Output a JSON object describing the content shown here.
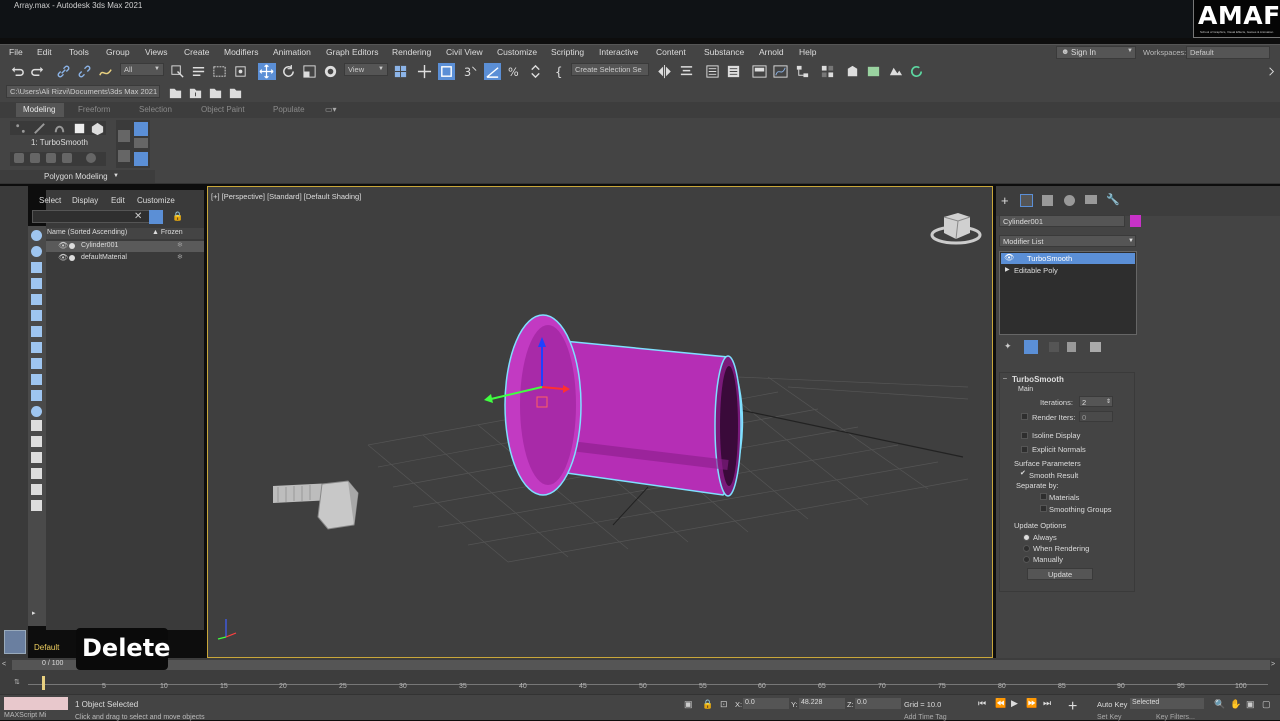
{
  "title": "Array.max - Autodesk 3ds Max 2021",
  "logo": {
    "text": "AMAFHH",
    "subtitle": "School of Graphics, Visual Effects, Games & Animation"
  },
  "menu": [
    "File",
    "Edit",
    "Tools",
    "Group",
    "Views",
    "Create",
    "Modifiers",
    "Animation",
    "Graph Editors",
    "Rendering",
    "Civil View",
    "Customize",
    "Scripting",
    "Interactive",
    "Content",
    "Substance",
    "Arnold",
    "Help"
  ],
  "account": {
    "sign_in": "Sign In",
    "workspaces_label": "Workspaces:",
    "workspace": "Default"
  },
  "toolbar": {
    "selection_filter": "All",
    "ref_coord": "View",
    "create_selection_set": "Create Selection Se"
  },
  "project_path": "C:\\Users\\Ali Rizvi\\Documents\\3ds Max 2021",
  "ribbon_tabs": [
    "Modeling",
    "Freeform",
    "Selection",
    "Object Paint",
    "Populate"
  ],
  "ribbon": {
    "modifier_label": "1: TurboSmooth",
    "group": "Polygon Modeling"
  },
  "scene_explorer": {
    "menus": [
      "Select",
      "Display",
      "Edit",
      "Customize"
    ],
    "col_name": "Name (Sorted Ascending)",
    "col_frozen": "▲ Frozen",
    "items": [
      "Cylinder001",
      "defaultMaterial"
    ],
    "layer": "Default"
  },
  "viewport": {
    "label": "[+] [Perspective] [Standard] [Default Shading]"
  },
  "command_panel": {
    "object_name": "Cylinder001",
    "object_color": "#c832c8",
    "modifier_list": "Modifier List",
    "stack": [
      "TurboSmooth",
      "Editable Poly"
    ],
    "rollout_title": "TurboSmooth",
    "main": "Main",
    "iterations_label": "Iterations:",
    "iterations": "2",
    "render_iters_label": "Render Iters:",
    "render_iters": "0",
    "isoline": "Isoline Display",
    "explicit_normals": "Explicit Normals",
    "surface_params": "Surface Parameters",
    "smooth_result": "Smooth Result",
    "separate_by": "Separate by:",
    "materials": "Materials",
    "smoothing_groups": "Smoothing Groups",
    "update_options": "Update Options",
    "always": "Always",
    "when_rendering": "When Rendering",
    "manually": "Manually",
    "update_btn": "Update"
  },
  "timeline": {
    "frame": "0 / 100",
    "ticks": [
      "5",
      "10",
      "15",
      "20",
      "25",
      "30",
      "35",
      "40",
      "45",
      "50",
      "55",
      "60",
      "65",
      "70",
      "75",
      "80",
      "85",
      "90",
      "95",
      "100"
    ]
  },
  "status": {
    "selected": "1 Object Selected",
    "hint": "Click and drag to select and move objects",
    "maxscript": "MAXScript Mi",
    "x_label": "X:",
    "x": "0.0",
    "y_label": "Y:",
    "y": "48.228",
    "z_label": "Z:",
    "z": "0.0",
    "grid": "Grid = 10.0",
    "add_time_tag": "Add Time Tag",
    "auto_key": "Auto Key",
    "set_key": "Set Key",
    "selected_mode": "Selected",
    "key_filters": "Key Filters..."
  },
  "overlay": {
    "text": "Delete"
  },
  "colors": {
    "accent": "#5b8fd6",
    "cylinder": "#c832c8",
    "highlight": "#7fe0ff",
    "active_border": "#c9a73a"
  }
}
